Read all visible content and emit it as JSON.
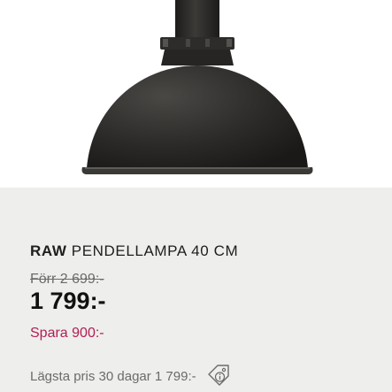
{
  "product": {
    "brand": "RAW",
    "name": "PENDELLAMPA 40 CM",
    "old_price": "Förr 2 699:-",
    "price": "1 799:-",
    "savings": "Spara 900:-",
    "lowest_price_note": "Lägsta pris 30 dagar 1 799:-"
  },
  "icons": {
    "price_info": "price-tag-info-icon"
  },
  "colors": {
    "info_background": "#eeeeec",
    "savings_text": "#b31d55",
    "lamp": "#2a2927"
  }
}
